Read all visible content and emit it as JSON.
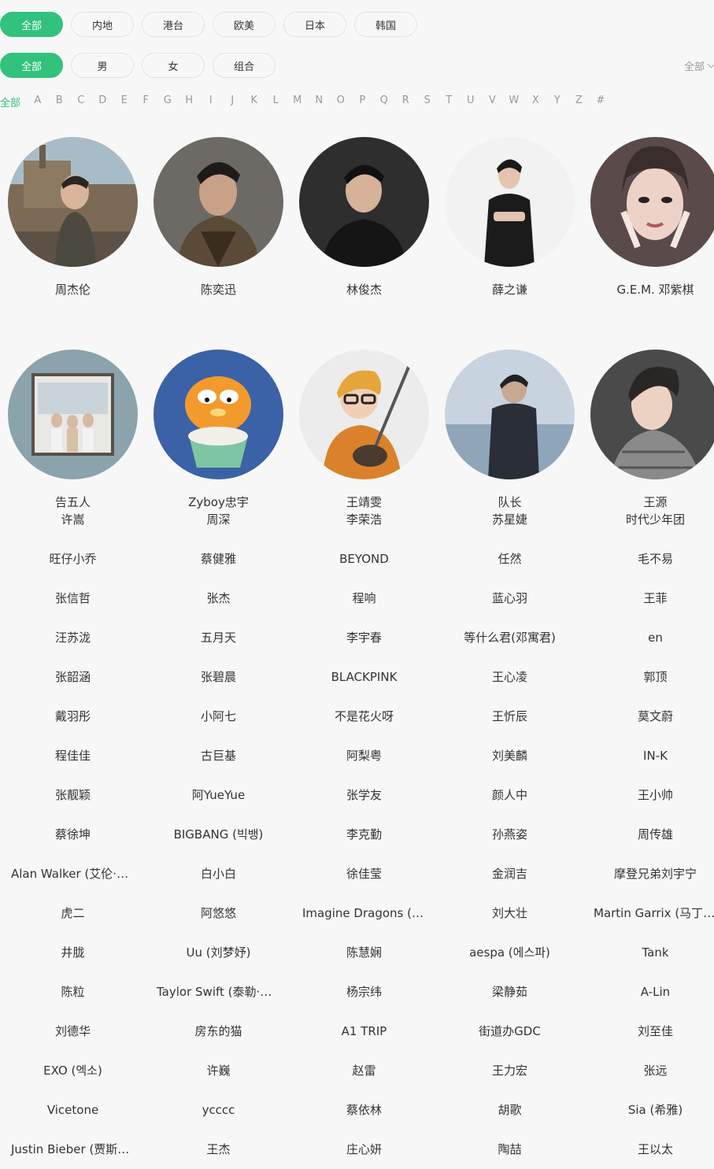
{
  "filters": {
    "area": [
      "全部",
      "内地",
      "港台",
      "欧美",
      "日本",
      "韩国"
    ],
    "gender": [
      "全部",
      "男",
      "女",
      "组合"
    ],
    "sort_label": "全部",
    "letters_active": "全部",
    "letters": [
      "A",
      "B",
      "C",
      "D",
      "E",
      "F",
      "G",
      "H",
      "I",
      "J",
      "K",
      "L",
      "M",
      "N",
      "O",
      "P",
      "Q",
      "R",
      "S",
      "T",
      "U",
      "V",
      "W",
      "X",
      "Y",
      "Z",
      "#"
    ]
  },
  "featured": [
    {
      "name": "周杰伦",
      "icon": "singer-avatar"
    },
    {
      "name": "陈奕迅",
      "icon": "singer-avatar"
    },
    {
      "name": "林俊杰",
      "icon": "singer-avatar"
    },
    {
      "name": "薛之谦",
      "icon": "singer-avatar"
    },
    {
      "name": "G.E.M. 邓紫棋",
      "icon": "singer-avatar"
    },
    {
      "name": "告五人",
      "icon": "band-avatar"
    },
    {
      "name": "Zyboy忠宇",
      "icon": "cartoon-cat-avatar"
    },
    {
      "name": "王靖雯",
      "icon": "singer-avatar"
    },
    {
      "name": "队长",
      "icon": "singer-avatar"
    },
    {
      "name": "王源",
      "icon": "singer-avatar"
    }
  ],
  "singers": [
    "许嵩",
    "周深",
    "李荣浩",
    "苏星婕",
    "时代少年团",
    "旺仔小乔",
    "蔡健雅",
    "BEYOND",
    "任然",
    "毛不易",
    "张信哲",
    "张杰",
    "程响",
    "蓝心羽",
    "王菲",
    "汪苏泷",
    "五月天",
    "李宇春",
    "等什么君(邓寓君)",
    "en",
    "张韶涵",
    "张碧晨",
    "BLACKPINK",
    "王心凌",
    "郭顶",
    "戴羽彤",
    "小阿七",
    "不是花火呀",
    "王忻辰",
    "莫文蔚",
    "程佳佳",
    "古巨基",
    "阿梨粤",
    "刘美麟",
    "IN-K",
    "张靓颖",
    "阿YueYue",
    "张学友",
    "颜人中",
    "王小帅",
    "蔡徐坤",
    "BIGBANG (빅뱅)",
    "李克勤",
    "孙燕姿",
    "周传雄",
    "Alan Walker (艾伦·沃克)",
    "白小白",
    "徐佳莹",
    "金润吉",
    "摩登兄弟刘宇宁",
    "虎二",
    "阿悠悠",
    "Imagine Dragons (梦龙)",
    "刘大壮",
    "Martin Garrix (马丁·盖瑞斯)",
    "井胧",
    "Uu (刘梦妤)",
    "陈慧娴",
    "aespa (에스파)",
    "Tank",
    "陈粒",
    "Taylor Swift (泰勒·斯威夫特)",
    "杨宗纬",
    "梁静茹",
    "A-Lin",
    "刘德华",
    "房东的猫",
    "A1 TRIP",
    "街道办GDC",
    "刘至佳",
    "EXO (엑소)",
    "许巍",
    "赵雷",
    "王力宏",
    "张远",
    "Vicetone",
    "ycccc",
    "蔡依林",
    "胡歌",
    "Sia (希雅)",
    "Justin Bieber (贾斯汀·比伯)",
    "王杰",
    "庄心妍",
    "陶喆",
    "王以太"
  ],
  "colors": {
    "accent": "#31c27c",
    "background": "#f7f7f7"
  }
}
